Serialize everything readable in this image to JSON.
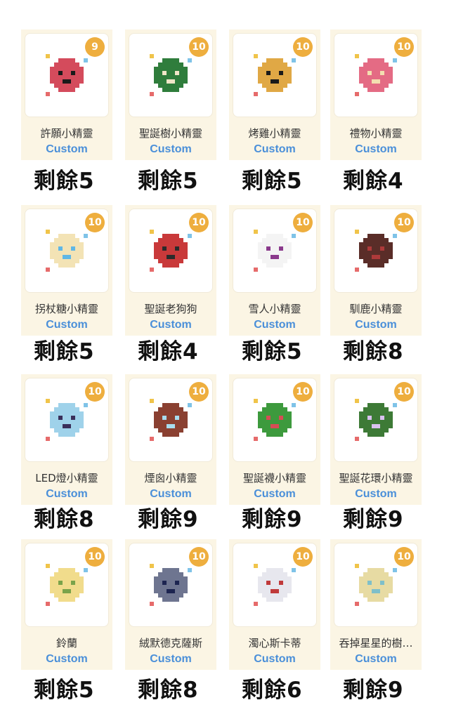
{
  "items": [
    {
      "badge": "9",
      "name": "許願小精靈",
      "tag": "Custom",
      "remain": "剩餘5",
      "main": "#d44b5c",
      "accent": "#1a1a1a"
    },
    {
      "badge": "10",
      "name": "聖誕樹小精靈",
      "tag": "Custom",
      "remain": "剩餘5",
      "main": "#2f7d3c",
      "accent": "#f1e6c8"
    },
    {
      "badge": "10",
      "name": "烤雞小精靈",
      "tag": "Custom",
      "remain": "剩餘5",
      "main": "#e0a845",
      "accent": "#1a1a1a"
    },
    {
      "badge": "10",
      "name": "禮物小精靈",
      "tag": "Custom",
      "remain": "剩餘4",
      "main": "#e46b84",
      "accent": "#f3dfb0"
    },
    {
      "badge": "10",
      "name": "拐杖糖小精靈",
      "tag": "Custom",
      "remain": "剩餘5",
      "main": "#f3e3b5",
      "accent": "#5fb7e6"
    },
    {
      "badge": "10",
      "name": "聖誕老狗狗",
      "tag": "Custom",
      "remain": "剩餘4",
      "main": "#c9393a",
      "accent": "#2b2b2b"
    },
    {
      "badge": "10",
      "name": "雪人小精靈",
      "tag": "Custom",
      "remain": "剩餘5",
      "main": "#f4f4f4",
      "accent": "#8a3a8c"
    },
    {
      "badge": "10",
      "name": "馴鹿小精靈",
      "tag": "Custom",
      "remain": "剩餘8",
      "main": "#5a2d28",
      "accent": "#ad3a3a"
    },
    {
      "badge": "10",
      "name": "LED燈小精靈",
      "tag": "Custom",
      "remain": "剩餘8",
      "main": "#9fd2ea",
      "accent": "#3a2f5a"
    },
    {
      "badge": "10",
      "name": "煙囪小精靈",
      "tag": "Custom",
      "remain": "剩餘9",
      "main": "#8a4031",
      "accent": "#a8dcee"
    },
    {
      "badge": "10",
      "name": "聖誕襪小精靈",
      "tag": "Custom",
      "remain": "剩餘9",
      "main": "#3d9a3d",
      "accent": "#d64d55"
    },
    {
      "badge": "10",
      "name": "聖誕花環小精靈",
      "tag": "Custom",
      "remain": "剩餘9",
      "main": "#3d7a36",
      "accent": "#d9c2ef"
    },
    {
      "badge": "10",
      "name": "鈴蘭",
      "tag": "Custom",
      "remain": "剩餘5",
      "main": "#f1dc8c",
      "accent": "#7aa34a"
    },
    {
      "badge": "10",
      "name": "絨默德克薩斯",
      "tag": "Custom",
      "remain": "剩餘8",
      "main": "#6e7590",
      "accent": "#1c2450"
    },
    {
      "badge": "10",
      "name": "濁心斯卡蒂",
      "tag": "Custom",
      "remain": "剩餘6",
      "main": "#e7e7ee",
      "accent": "#c03a3a"
    },
    {
      "badge": "10",
      "name": "吞掉星星的樹…",
      "tag": "Custom",
      "remain": "剩餘9",
      "main": "#e7dba3",
      "accent": "#7fbfc9"
    }
  ]
}
